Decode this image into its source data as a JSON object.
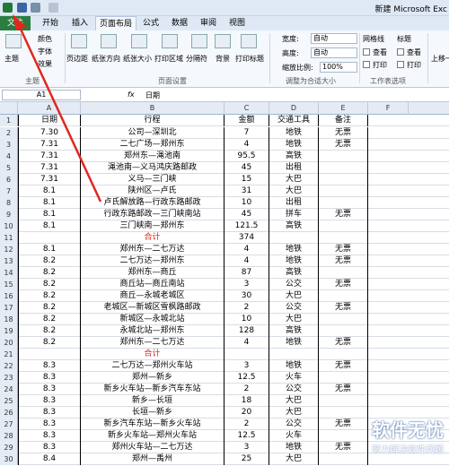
{
  "title_bar": {
    "title": "新建 Microsoft Exc"
  },
  "tabs": [
    "文件",
    "开始",
    "插入",
    "页面布局",
    "公式",
    "数据",
    "审阅",
    "视图"
  ],
  "ribbon": {
    "theme": "主题",
    "colors": "颜色",
    "fonts": "字体",
    "effects": "效果",
    "margins": "页边距",
    "orientation": "纸张方向",
    "size": "纸张大小",
    "print_area": "打印区域",
    "breaks": "分隔符",
    "background": "背景",
    "print_titles": "打印标题",
    "width_label": "宽度:",
    "width_val": "自动",
    "height_label": "高度:",
    "height_val": "自动",
    "scale_label": "缩放比例:",
    "scale_val": "100%",
    "gridlines": "网格线",
    "headings": "标题",
    "view": "查看",
    "print": "打印",
    "up": "上移一",
    "grp_theme": "主题",
    "grp_setup": "页面设置",
    "grp_fit": "调整为合适大小",
    "grp_sheet": "工作表选项"
  },
  "formula_bar": {
    "cell": "A1",
    "fx": "fx",
    "value": "日期"
  },
  "columns": [
    "A",
    "B",
    "C",
    "D",
    "E",
    "F"
  ],
  "headers": [
    "日期",
    "行程",
    "金额",
    "交通工具",
    "备注"
  ],
  "rows": [
    [
      "2",
      "7.30",
      "公司—深圳北",
      "7",
      "地铁",
      "无票"
    ],
    [
      "3",
      "7.31",
      "二七广场—郑州东",
      "4",
      "地铁",
      "无票"
    ],
    [
      "4",
      "7.31",
      "郑州东—渑池南",
      "95.5",
      "高铁",
      ""
    ],
    [
      "5",
      "7.31",
      "渑池南—义马鸿庆路邮政",
      "45",
      "出租",
      ""
    ],
    [
      "6",
      "7.31",
      "义马—三门峡",
      "15",
      "大巴",
      ""
    ],
    [
      "7",
      "8.1",
      "陕州区—卢氏",
      "31",
      "大巴",
      ""
    ],
    [
      "8",
      "8.1",
      "卢氏解放路—行政东路邮政",
      "10",
      "出租",
      ""
    ],
    [
      "9",
      "8.1",
      "行政东路邮政—三门峡南站",
      "45",
      "拼车",
      "无票"
    ],
    [
      "10",
      "8.1",
      "三门峡南—郑州东",
      "121.5",
      "高铁",
      ""
    ],
    [
      "11",
      "",
      "合计",
      "374",
      "",
      ""
    ],
    [
      "12",
      "8.1",
      "郑州东—二七万达",
      "4",
      "地铁",
      "无票"
    ],
    [
      "13",
      "8.2",
      "二七万达—郑州东",
      "4",
      "地铁",
      "无票"
    ],
    [
      "14",
      "8.2",
      "郑州东—商丘",
      "87",
      "高铁",
      ""
    ],
    [
      "15",
      "8.2",
      "商丘站—商丘南站",
      "3",
      "公交",
      "无票"
    ],
    [
      "16",
      "8.2",
      "商丘—永城老城区",
      "30",
      "大巴",
      ""
    ],
    [
      "17",
      "8.2",
      "老城区—新城区雪枫路邮政",
      "2",
      "公交",
      "无票"
    ],
    [
      "18",
      "8.2",
      "新城区—永城北站",
      "10",
      "大巴",
      ""
    ],
    [
      "19",
      "8.2",
      "永城北站—郑州东",
      "128",
      "高铁",
      ""
    ],
    [
      "20",
      "8.2",
      "郑州东—二七万达",
      "4",
      "地铁",
      "无票"
    ],
    [
      "21",
      "",
      "合计",
      "",
      "",
      ""
    ],
    [
      "22",
      "8.3",
      "二七万达—郑州火车站",
      "3",
      "地铁",
      "无票"
    ],
    [
      "23",
      "8.3",
      "郑州—新乡",
      "12.5",
      "火车",
      ""
    ],
    [
      "24",
      "8.3",
      "新乡火车站—新乡汽车东站",
      "2",
      "公交",
      "无票"
    ],
    [
      "25",
      "8.3",
      "新乡—长垣",
      "18",
      "大巴",
      ""
    ],
    [
      "26",
      "8.3",
      "长垣—新乡",
      "20",
      "大巴",
      ""
    ],
    [
      "27",
      "8.3",
      "新乡汽车东站—新乡火车站",
      "2",
      "公交",
      "无票"
    ],
    [
      "28",
      "8.3",
      "新乡火车站—郑州火车站",
      "12.5",
      "火车",
      ""
    ],
    [
      "29",
      "8.3",
      "郑州火车站—二七万达",
      "3",
      "地铁",
      "无票"
    ],
    [
      "30",
      "8.4",
      "郑州—禹州",
      "25",
      "大巴",
      ""
    ]
  ],
  "watermark": {
    "brand": "软件无忧",
    "slogan": "努力解决软件问题"
  }
}
